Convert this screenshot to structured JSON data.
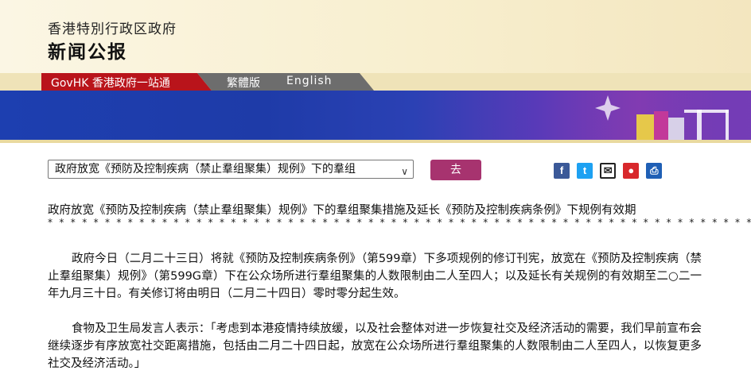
{
  "header": {
    "org_name": "香港特別行政区政府",
    "press_release": "新闻公报"
  },
  "nav": {
    "govhk": "GovHK 香港政府一站通",
    "traditional": "繁體版",
    "english": "English"
  },
  "toolbar": {
    "selected_article": "政府放宽《预防及控制疾病（禁止羣组聚集）规例》下的羣组",
    "go_label": "去",
    "share_icons": [
      "facebook-icon",
      "twitter-icon",
      "email-icon",
      "weibo-icon",
      "print-icon"
    ]
  },
  "article": {
    "title": "政府放宽《预防及控制疾病（禁止羣组聚集）规例》下的羣组聚集措施及延长《预防及控制疾病条例》下规例有效期",
    "stars": "**************************************************************",
    "paragraph_1": "政府今日（二月二十三日）将就《预防及控制疾病条例》（第599章）下多项规例的修订刊宪，放宽在《预防及控制疾病（禁止羣组聚集）规例》（第599G章）下在公众场所进行羣组聚集的人数限制由二人至四人；以及延长有关规例的有效期至二○二一年九月三十日。有关修订将由明日（二月二十四日）零时零分起生效。",
    "paragraph_2": "食物及卫生局发言人表示：「考虑到本港疫情持续放缓，以及社会整体对进一步恢复社交及经济活动的需要，我们早前宣布会继续逐步有序放宽社交距离措施，包括由二月二十四日起，放宽在公众场所进行羣组聚集的人数限制由二人至四人，以恢复更多社交及经济活动。」"
  },
  "colors": {
    "nav_red": "#b9141b",
    "nav_grey": "#6d6d6d",
    "go_button": "#a7336f",
    "banner_blue": "#1d3fb0"
  }
}
